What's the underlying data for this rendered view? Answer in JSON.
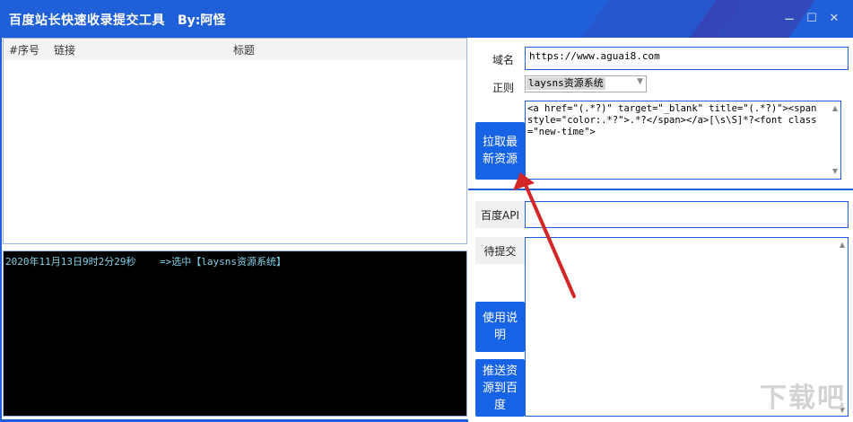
{
  "window": {
    "title": "百度站长快速收录提交工具",
    "author": "By:阿怪",
    "controls": {
      "minimize": "−",
      "maximize": "☐",
      "close": "✕"
    }
  },
  "list": {
    "columns": [
      "#序号",
      "链接",
      "标题"
    ],
    "rows": []
  },
  "console": {
    "lines": [
      "2020年11月13日9时2分29秒    =>选中【laysns资源系统】"
    ]
  },
  "form": {
    "domain_label": "域名",
    "domain_value": "https://www.aguai8.com",
    "rule_label": "正则",
    "rule_selected": "laysns资源系统",
    "regex_value": "<a href=\"(.*?)\" target=\"_blank\" title=\"(.*?)\"><span style=\"color:.*?\">.*?</span></a>[\\s\\S]*?<font class=\"new-time\">",
    "fetch_button": "拉取最新资源",
    "api_label": "百度API",
    "api_value": "",
    "pending_label": "待提交",
    "pending_value": "",
    "help_button": "使用说明",
    "push_button": "推送资源到百度"
  },
  "watermark": "下载吧",
  "colors": {
    "titlebar": "#1f5fd8",
    "button": "#1763e6",
    "console_text": "#7fd1e6",
    "arrow": "#d42626"
  }
}
